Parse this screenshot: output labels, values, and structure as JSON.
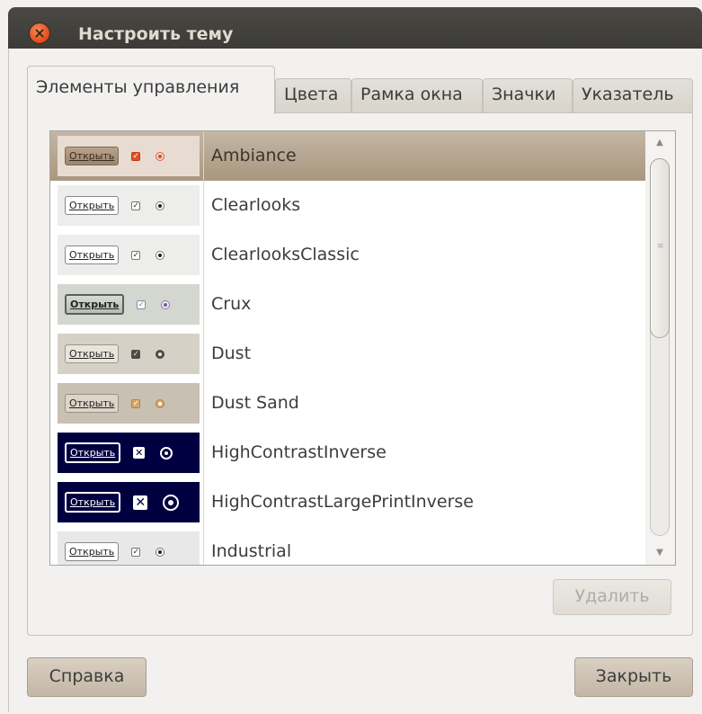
{
  "window": {
    "title": "Настроить тему"
  },
  "tabs": [
    {
      "label": "Элементы управления",
      "active": true
    },
    {
      "label": "Цвета",
      "active": false
    },
    {
      "label": "Рамка окна",
      "active": false
    },
    {
      "label": "Значки",
      "active": false
    },
    {
      "label": "Указатель",
      "active": false
    }
  ],
  "preview": {
    "button_label": "Открыть",
    "checkbox_mark": "✓",
    "hc_checkbox_mark": "✕"
  },
  "themes": [
    {
      "name": "Ambiance",
      "selected": true
    },
    {
      "name": "Clearlooks"
    },
    {
      "name": "ClearlooksClassic"
    },
    {
      "name": "Crux"
    },
    {
      "name": "Dust"
    },
    {
      "name": "Dust Sand"
    },
    {
      "name": "HighContrastInverse"
    },
    {
      "name": "HighContrastLargePrintInverse"
    },
    {
      "name": "Industrial"
    }
  ],
  "buttons": {
    "delete": "Удалить",
    "help": "Справка",
    "close": "Закрыть"
  },
  "colors": {
    "titlebar": "#3c3b37",
    "selection": "#a9977f",
    "accent": "#df4a16"
  }
}
